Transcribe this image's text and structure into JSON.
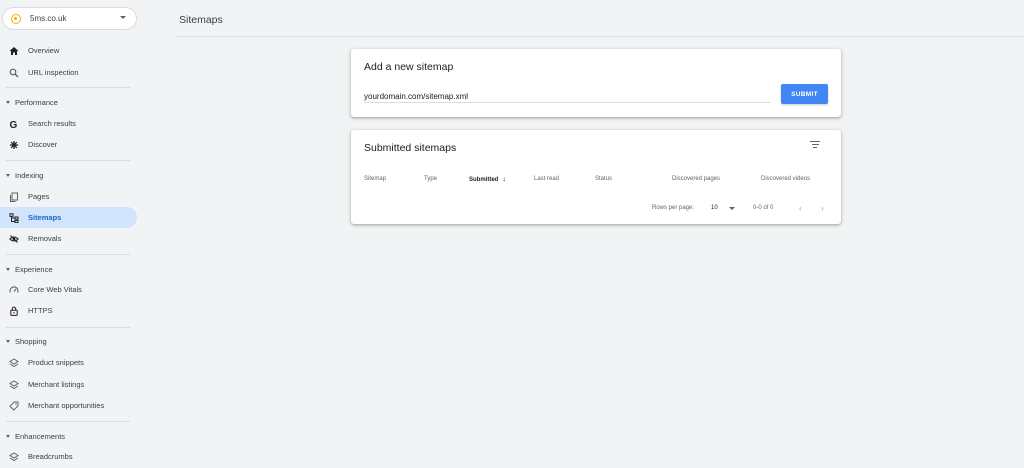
{
  "property": {
    "name": "5ms.co.uk"
  },
  "sidebar": {
    "overview": "Overview",
    "url_inspection": "URL inspection",
    "performance_section": "Performance",
    "search_results": "Search results",
    "discover": "Discover",
    "indexing_section": "Indexing",
    "pages": "Pages",
    "sitemaps": "Sitemaps",
    "removals": "Removals",
    "experience_section": "Experience",
    "core_web_vitals": "Core Web Vitals",
    "https": "HTTPS",
    "shopping_section": "Shopping",
    "product_snippets": "Product snippets",
    "merchant_listings": "Merchant listings",
    "merchant_opportunities": "Merchant opportunities",
    "enhancements_section": "Enhancements",
    "breadcrumbs": "Breadcrumbs"
  },
  "header": {
    "title": "Sitemaps"
  },
  "add_sitemap": {
    "title": "Add a new sitemap",
    "input_value": "yourdomain.com/sitemap.xml",
    "submit_label": "SUBMIT"
  },
  "submitted": {
    "title": "Submitted sitemaps",
    "columns": [
      "Sitemap",
      "Type",
      "Submitted",
      "Last read",
      "Status",
      "Discovered pages",
      "Discovered videos"
    ],
    "sort_arrow": "↓",
    "rows_per_page_label": "Rows per page:",
    "rows_per_page_value": "10",
    "range": "0-0 of 0",
    "prev": "‹",
    "next": "›"
  },
  "colors": {
    "accent": "#4285f4",
    "active_bg": "#d2e3fc",
    "active_text": "#1967d2"
  }
}
